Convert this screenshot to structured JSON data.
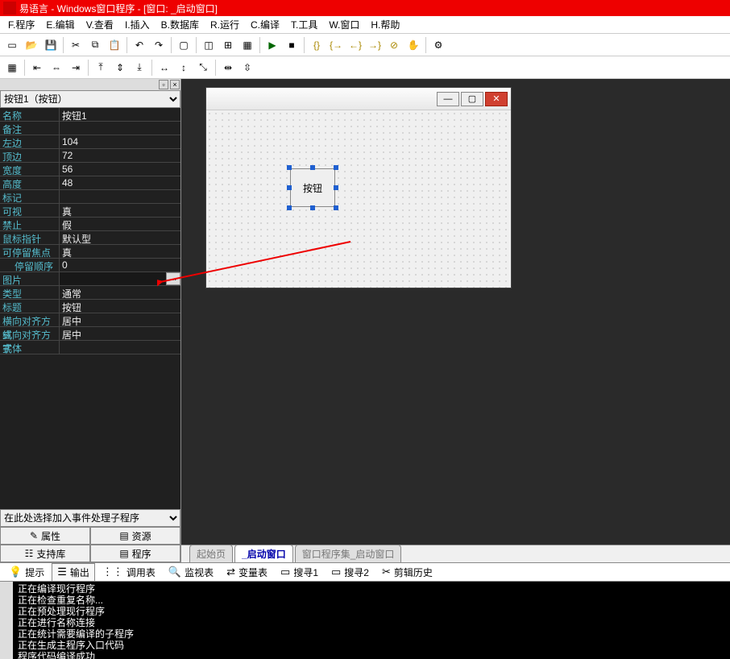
{
  "title": "易语言 - Windows窗口程序 - [窗口: _启动窗口]",
  "menu": [
    "F.程序",
    "E.编辑",
    "V.查看",
    "I.插入",
    "B.数据库",
    "R.运行",
    "C.编译",
    "T.工具",
    "W.窗口",
    "H.帮助"
  ],
  "selector": "按钮1（按钮）",
  "properties": [
    {
      "name": "名称",
      "value": "按钮1"
    },
    {
      "name": "备注",
      "value": ""
    },
    {
      "name": "左边",
      "value": "104"
    },
    {
      "name": "顶边",
      "value": "72"
    },
    {
      "name": "宽度",
      "value": "56"
    },
    {
      "name": "高度",
      "value": "48"
    },
    {
      "name": "标记",
      "value": ""
    },
    {
      "name": "可视",
      "value": "真"
    },
    {
      "name": "禁止",
      "value": "假"
    },
    {
      "name": "鼠标指针",
      "value": "默认型"
    },
    {
      "name": "可停留焦点",
      "value": "真"
    },
    {
      "name": "停留顺序",
      "value": "0",
      "indent": true
    },
    {
      "name": "图片",
      "value": "",
      "btn": "..."
    },
    {
      "name": "类型",
      "value": "通常"
    },
    {
      "name": "标题",
      "value": "按钮"
    },
    {
      "name": "横向对齐方式",
      "value": "居中"
    },
    {
      "name": "纵向对齐方式",
      "value": "居中"
    },
    {
      "name": "字体",
      "value": ""
    }
  ],
  "event_selector": "在此处选择加入事件处理子程序",
  "lefttabs": {
    "attr": "属性",
    "res": "资源",
    "lib": "支持库",
    "prog": "程序"
  },
  "button_caption": "按钮",
  "doctabs": [
    "起始页",
    "_启动窗口",
    "窗口程序集_启动窗口"
  ],
  "bottomtabs": [
    "提示",
    "输出",
    "调用表",
    "监视表",
    "变量表",
    "搜寻1",
    "搜寻2",
    "剪辑历史"
  ],
  "output_lines": [
    "正在编译现行程序",
    "正在检查重复名称...",
    "正在预处理现行程序",
    "正在进行名称连接",
    "正在统计需要编译的子程序",
    "正在生成主程序入口代码",
    "程序代码编译成功"
  ],
  "icons": {
    "lamp": "💡",
    "list": "☰",
    "grid": "⋮⋮",
    "search": "🔍",
    "swap": "⇄",
    "doc": "▭",
    "scissors": "✂"
  }
}
